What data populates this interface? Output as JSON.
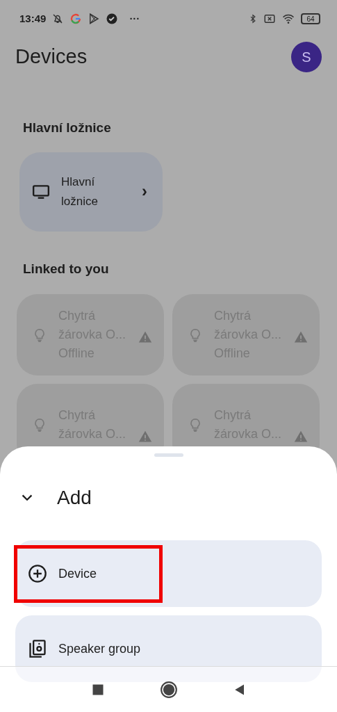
{
  "status_bar": {
    "time": "13:49",
    "more": "···",
    "battery": "64"
  },
  "header": {
    "title": "Devices",
    "avatar": "S"
  },
  "rooms": {
    "title": "Hlavní ložnice",
    "items": [
      {
        "name": "Hlavní ložnice",
        "chevron": "›"
      }
    ]
  },
  "linked": {
    "title": "Linked to you",
    "devices": [
      {
        "name": "Chytrá žárovka O...",
        "status": "Offline",
        "warning": true
      },
      {
        "name": "Chytrá žárovka O...",
        "status": "Offline",
        "warning": true
      },
      {
        "name": "Chytrá žárovka O...",
        "warning": true
      },
      {
        "name": "Chytrá žárovka O...",
        "warning": true
      }
    ]
  },
  "sheet": {
    "title": "Add",
    "options": [
      {
        "kind": "device",
        "label": "Device",
        "highlighted": true
      },
      {
        "kind": "speaker_group",
        "label": "Speaker group",
        "highlighted": false
      }
    ]
  }
}
